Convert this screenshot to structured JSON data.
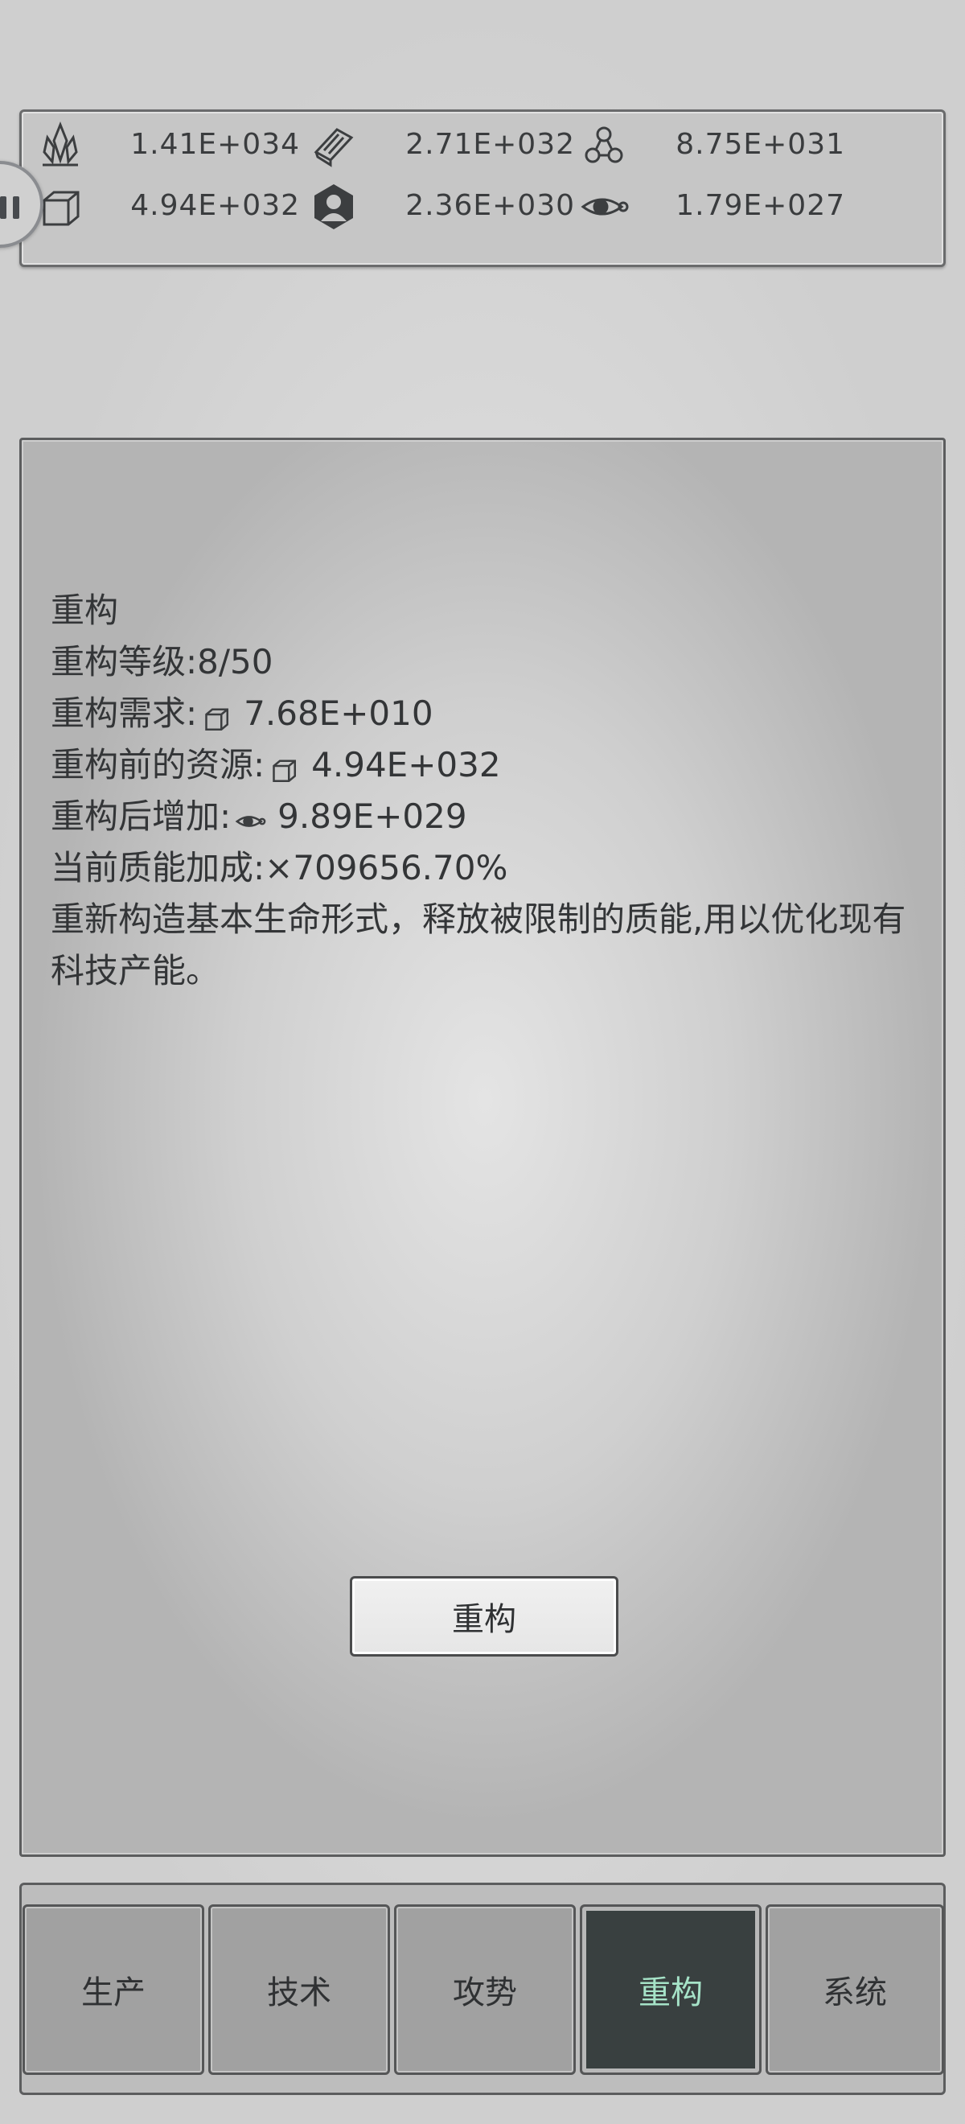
{
  "resources": [
    {
      "icon": "crystal-icon",
      "value": "1.41E+034"
    },
    {
      "icon": "ingot-icon",
      "value": "2.71E+032"
    },
    {
      "icon": "molecule-icon",
      "value": "8.75E+031"
    },
    {
      "icon": "cube-icon",
      "value": "4.94E+032"
    },
    {
      "icon": "population-icon",
      "value": "2.36E+030"
    },
    {
      "icon": "eye-orbit-icon",
      "value": "1.79E+027"
    }
  ],
  "rebuild": {
    "title": "重构",
    "level_label": "重构等级:",
    "level_value": "8/50",
    "requirement_label": "重构需求:",
    "requirement_icon": "cube-icon",
    "requirement_value": "7.68E+010",
    "before_label": "重构前的资源:",
    "before_icon": "cube-icon",
    "before_value": "4.94E+032",
    "gain_label": "重构后增加:",
    "gain_icon": "eye-orbit-icon",
    "gain_value": "9.89E+029",
    "bonus_label": "当前质能加成:",
    "bonus_value": "×709656.70%",
    "description": "重新构造基本生命形式，释放被限制的质能,用以优化现有科技产能。",
    "button_label": "重构"
  },
  "tabs": [
    {
      "label": "生产",
      "active": false
    },
    {
      "label": "技术",
      "active": false
    },
    {
      "label": "攻势",
      "active": false
    },
    {
      "label": "重构",
      "active": true
    },
    {
      "label": "系统",
      "active": false
    }
  ],
  "colors": {
    "active_tab_bg": "#394040",
    "active_tab_text": "#a6e3c8",
    "panel_border": "#5c5d5e"
  }
}
